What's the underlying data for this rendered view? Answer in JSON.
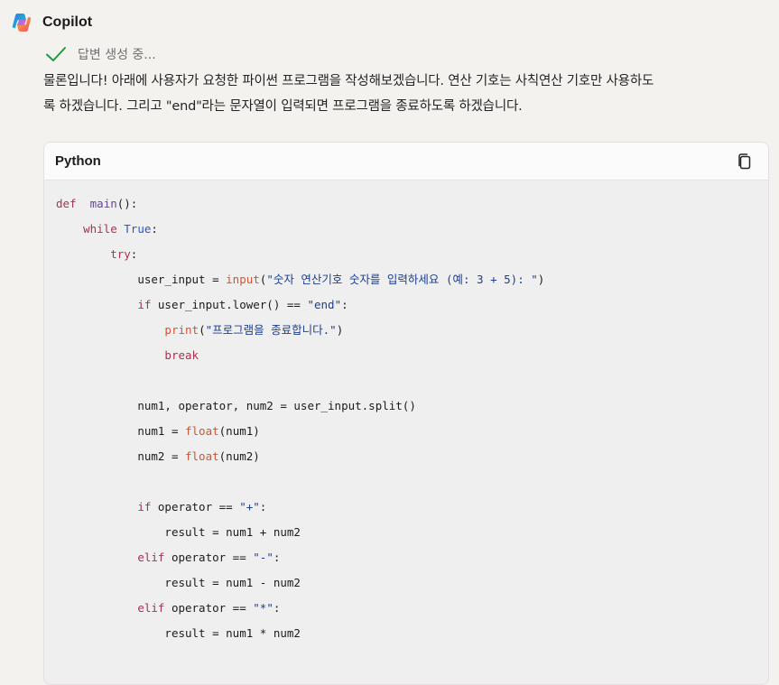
{
  "app": {
    "name": "Copilot"
  },
  "status": {
    "text": "답변 생성 중..."
  },
  "message": {
    "line1": "물론입니다! 아래에 사용자가 요청한 파이썬 프로그램을 작성해보겠습니다. 연산 기호는 사칙연산 기호만 사용하도",
    "line2": "록 하겠습니다. 그리고 \"end\"라는 문자열이 입력되면 프로그램을 종료하도록 하겠습니다."
  },
  "code_block": {
    "language": "Python",
    "lines": [
      {
        "indent": 0,
        "tokens": [
          [
            "kw",
            "def"
          ],
          [
            "",
            "  "
          ],
          [
            "fdef",
            "main"
          ],
          [
            "",
            "():"
          ]
        ]
      },
      {
        "indent": 1,
        "tokens": [
          [
            "kw",
            "while"
          ],
          [
            "",
            " "
          ],
          [
            "kw2",
            "True"
          ],
          [
            "",
            ":"
          ]
        ]
      },
      {
        "indent": 2,
        "tokens": [
          [
            "kw",
            "try"
          ],
          [
            "",
            ":"
          ]
        ]
      },
      {
        "indent": 3,
        "tokens": [
          [
            "",
            "user_input = "
          ],
          [
            "fn",
            "input"
          ],
          [
            "",
            "("
          ],
          [
            "str",
            "\"숫자 연산기호 숫자를 입력하세요 (예: 3 + 5): \""
          ],
          [
            "",
            ")"
          ]
        ]
      },
      {
        "indent": 3,
        "tokens": [
          [
            "kw",
            "if"
          ],
          [
            "",
            " user_input.lower() == "
          ],
          [
            "str",
            "\"end\""
          ],
          [
            "",
            ":"
          ]
        ]
      },
      {
        "indent": 4,
        "tokens": [
          [
            "fn",
            "print"
          ],
          [
            "",
            "("
          ],
          [
            "str",
            "\"프로그램을 종료합니다.\""
          ],
          [
            "",
            ")"
          ]
        ]
      },
      {
        "indent": 4,
        "tokens": [
          [
            "kw",
            "break"
          ]
        ]
      },
      {
        "indent": 0,
        "tokens": []
      },
      {
        "indent": 3,
        "tokens": [
          [
            "",
            "num1, operator, num2 = user_input.split()"
          ]
        ]
      },
      {
        "indent": 3,
        "tokens": [
          [
            "",
            "num1 = "
          ],
          [
            "fn",
            "float"
          ],
          [
            "",
            "(num1)"
          ]
        ]
      },
      {
        "indent": 3,
        "tokens": [
          [
            "",
            "num2 = "
          ],
          [
            "fn",
            "float"
          ],
          [
            "",
            "(num2)"
          ]
        ]
      },
      {
        "indent": 0,
        "tokens": []
      },
      {
        "indent": 3,
        "tokens": [
          [
            "kw",
            "if"
          ],
          [
            "",
            " operator == "
          ],
          [
            "str",
            "\"+\""
          ],
          [
            "",
            ":"
          ]
        ]
      },
      {
        "indent": 4,
        "tokens": [
          [
            "",
            "result = num1 + num2"
          ]
        ]
      },
      {
        "indent": 3,
        "tokens": [
          [
            "kw",
            "elif"
          ],
          [
            "",
            " operator == "
          ],
          [
            "str",
            "\"-\""
          ],
          [
            "",
            ":"
          ]
        ]
      },
      {
        "indent": 4,
        "tokens": [
          [
            "",
            "result = num1 - num2"
          ]
        ]
      },
      {
        "indent": 3,
        "tokens": [
          [
            "kw",
            "elif"
          ],
          [
            "",
            " operator == "
          ],
          [
            "str",
            "\"*\""
          ],
          [
            "",
            ":"
          ]
        ]
      },
      {
        "indent": 4,
        "tokens": [
          [
            "",
            "result = num1 * num2"
          ]
        ]
      }
    ]
  },
  "icons": {
    "logo": "copilot-logo",
    "status": "check-icon",
    "copy": "copy-icon"
  },
  "colors": {
    "background": "#f3f2ef",
    "keyword": "#af2f4f",
    "builtin": "#d6522e",
    "string": "#1c3f8f",
    "bool": "#2d55c6",
    "check": "#1a9e3c"
  }
}
